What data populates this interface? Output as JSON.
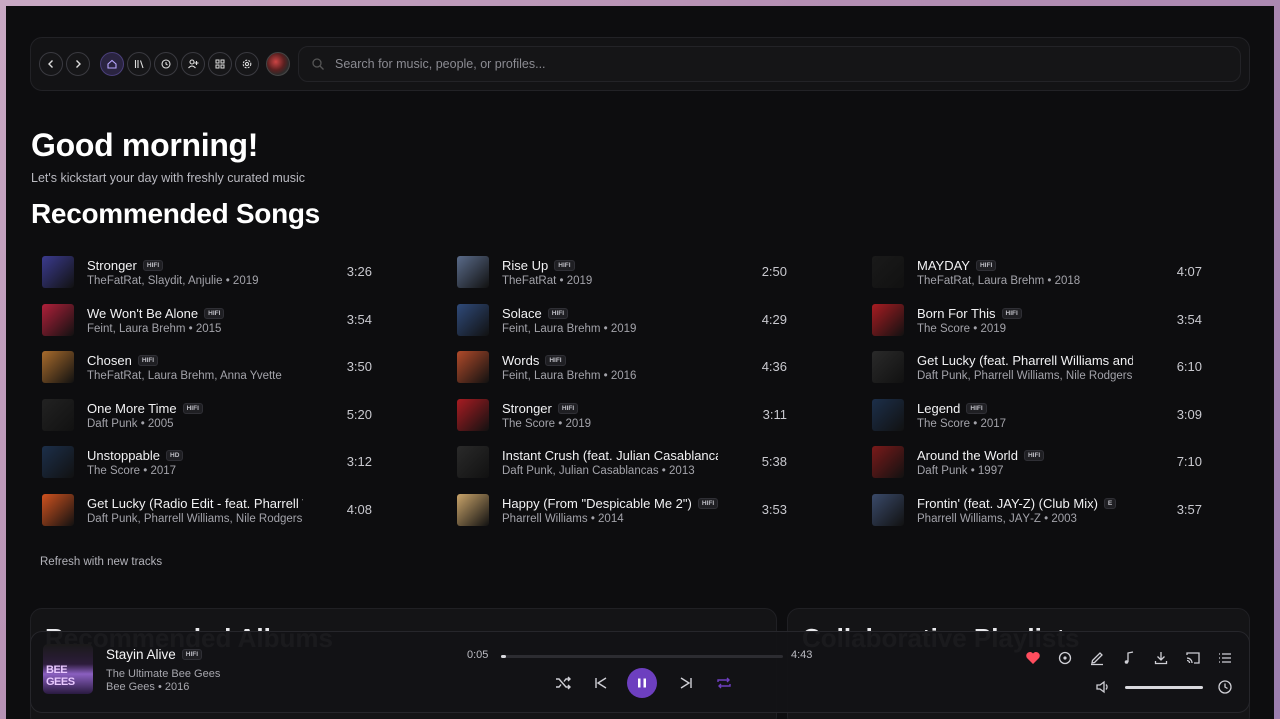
{
  "nav": {
    "search_placeholder": "Search for music, people, or profiles..."
  },
  "greeting": "Good morning!",
  "subtitle": "Let's kickstart your day with freshly curated music",
  "section_title": "Recommended Songs",
  "songs": [
    {
      "title": "Stronger",
      "badge": "HIFI",
      "meta": "TheFatRat, Slaydit, Anjulie • 2019",
      "duration": "3:26",
      "color": "#3b3b8f"
    },
    {
      "title": "We Won't Be Alone",
      "badge": "HIFI",
      "meta": "Feint, Laura Brehm • 2015",
      "duration": "3:54",
      "color": "#b0203a"
    },
    {
      "title": "Chosen",
      "badge": "HIFI",
      "meta": "TheFatRat, Laura Brehm, Anna Yvette",
      "duration": "3:50",
      "color": "#a86b2c"
    },
    {
      "title": "One More Time",
      "badge": "HIFI",
      "meta": "Daft Punk • 2005",
      "duration": "5:20",
      "color": "#222222"
    },
    {
      "title": "Unstoppable",
      "badge": "HD",
      "meta": "The Score • 2017",
      "duration": "3:12",
      "color": "#1c2f4a"
    },
    {
      "title": "Get Lucky (Radio Edit - feat. Pharrell Williams)",
      "badge": "HIFI",
      "meta": "Daft Punk, Pharrell Williams, Nile Rodgers",
      "duration": "4:08",
      "color": "#d0521f"
    },
    {
      "title": "Rise Up",
      "badge": "HIFI",
      "meta": "TheFatRat • 2019",
      "duration": "2:50",
      "color": "#5a6b8a"
    },
    {
      "title": "Solace",
      "badge": "HIFI",
      "meta": "Feint, Laura Brehm • 2019",
      "duration": "4:29",
      "color": "#2f4a7a"
    },
    {
      "title": "Words",
      "badge": "HIFI",
      "meta": "Feint, Laura Brehm • 2016",
      "duration": "4:36",
      "color": "#b04a2a"
    },
    {
      "title": "Stronger",
      "badge": "HIFI",
      "meta": "The Score • 2019",
      "duration": "3:11",
      "color": "#a81c22"
    },
    {
      "title": "Instant Crush (feat. Julian Casablancas)",
      "badge": "HIFI",
      "meta": "Daft Punk, Julian Casablancas • 2013",
      "duration": "5:38",
      "color": "#2a2a2a"
    },
    {
      "title": "Happy (From \"Despicable Me 2\")",
      "badge": "HIFI",
      "meta": "Pharrell Williams • 2014",
      "duration": "3:53",
      "color": "#c9a46a"
    },
    {
      "title": "MAYDAY",
      "badge": "HIFI",
      "meta": "TheFatRat, Laura Brehm • 2018",
      "duration": "4:07",
      "color": "#1a1a1a"
    },
    {
      "title": "Born For This",
      "badge": "HIFI",
      "meta": "The Score • 2019",
      "duration": "3:54",
      "color": "#a81c22"
    },
    {
      "title": "Get Lucky (feat. Pharrell Williams and Nile Rodgers)",
      "badge": "HIFI",
      "meta": "Daft Punk, Pharrell Williams, Nile Rodgers",
      "duration": "6:10",
      "color": "#2a2a2a"
    },
    {
      "title": "Legend",
      "badge": "HIFI",
      "meta": "The Score • 2017",
      "duration": "3:09",
      "color": "#1c2f4a"
    },
    {
      "title": "Around the World",
      "badge": "HIFI",
      "meta": "Daft Punk • 1997",
      "duration": "7:10",
      "color": "#7a1a1a"
    },
    {
      "title": "Frontin' (feat. JAY-Z) (Club Mix)",
      "badge": "E",
      "meta": "Pharrell Williams, JAŸ-Z • 2003",
      "duration": "3:57",
      "color": "#3a4a6a"
    }
  ],
  "refresh_label": "Refresh with new tracks",
  "cards": [
    {
      "title": "Recommended Albums"
    },
    {
      "title": "Collaborative Playlists"
    }
  ],
  "player": {
    "cover_text": "BEE GEES",
    "title": "Stayin Alive",
    "badge": "HIFI",
    "album": "The Ultimate Bee Gees",
    "artist_year": "Bee Gees • 2016",
    "elapsed": "0:05",
    "total": "4:43",
    "progress": 0.018,
    "volume": 1.0,
    "liked_color": "#ff4d5e",
    "accent": "#6d3fbf"
  }
}
